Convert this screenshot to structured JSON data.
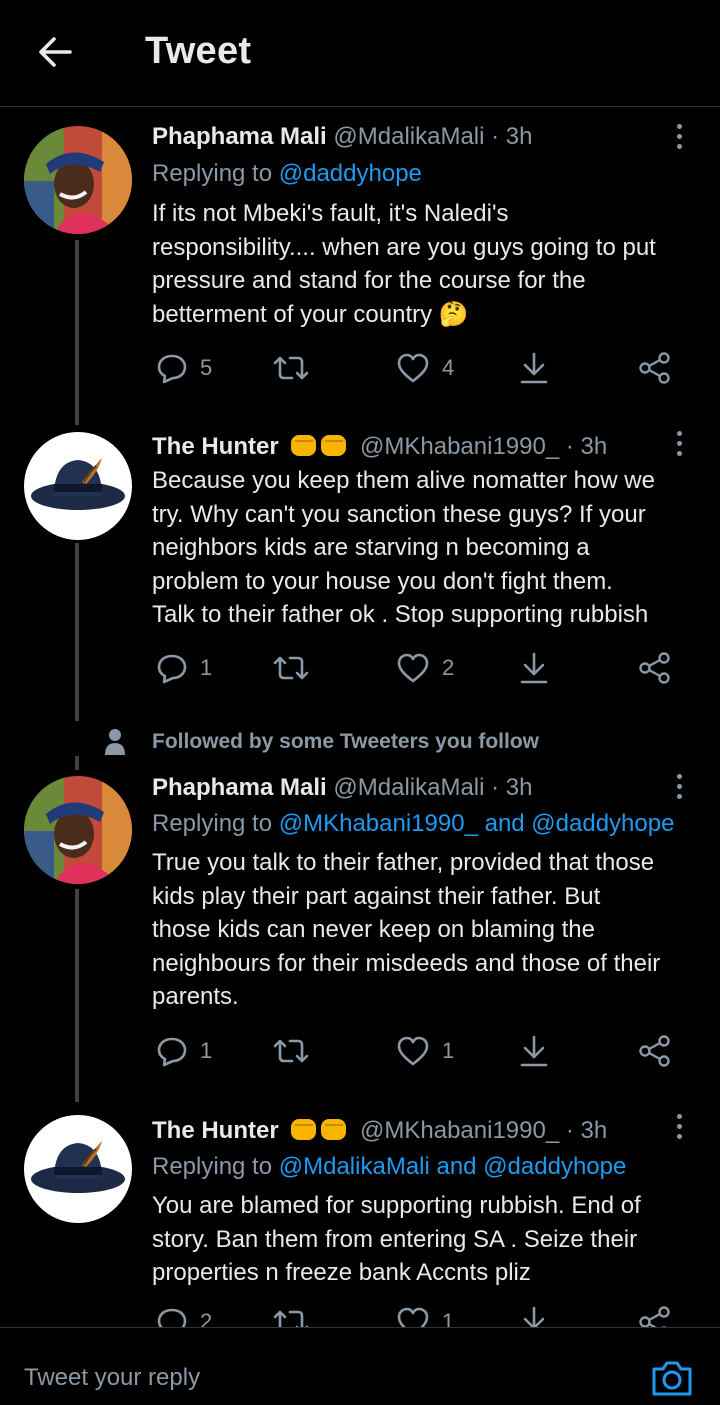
{
  "header": {
    "title": "Tweet"
  },
  "tweets": [
    {
      "name": "Phaphama Mali",
      "handle": "@MdalikaMali",
      "time": "· 3h",
      "reply_prefix": "Replying to ",
      "reply_to": "@daddyhope",
      "body": [
        "If its not Mbeki's fault, it's Naledi's",
        "responsibility.... when are you guys going to put",
        "pressure and stand for the course for the",
        "betterment of your country"
      ],
      "body_emoji": "🤔",
      "replies": "5",
      "retweets": "",
      "likes": "4"
    },
    {
      "name": "The Hunter",
      "handle": "@MKhabani1990_",
      "time": "· 3h",
      "body": [
        "Because you keep them alive nomatter how we",
        "try. Why can't you sanction these guys? If your",
        "neighbors kids are starving n becoming a",
        "problem to your house you don't fight them.",
        "Talk to their father ok . Stop supporting rubbish"
      ],
      "replies": "1",
      "retweets": "",
      "likes": "2"
    },
    {
      "name": "Phaphama Mali",
      "handle": "@MdalikaMali",
      "time": "· 3h",
      "reply_prefix": "Replying to ",
      "reply_to": "@MKhabani1990_ and @daddyhope",
      "body": [
        "True you talk to their father, provided that those",
        "kids play their part against their father. But",
        "those kids can never keep on blaming the",
        "neighbours for their misdeeds and those of their",
        "parents."
      ],
      "replies": "1",
      "retweets": "",
      "likes": "1"
    },
    {
      "name": "The Hunter",
      "handle": "@MKhabani1990_",
      "time": "· 3h",
      "reply_prefix": "Replying to ",
      "reply_to": "@MdalikaMali and @daddyhope",
      "body": [
        "You are blamed for supporting rubbish. End of",
        "story. Ban them from entering SA . Seize their",
        "properties n freeze bank Accnts pliz"
      ],
      "replies": "2",
      "retweets": "",
      "likes": "1"
    }
  ],
  "followed_notice": "Followed by some Tweeters you follow",
  "reply_bar": {
    "placeholder": "Tweet your reply"
  },
  "colors": {
    "background": "#000000",
    "text": "#e7e9ea",
    "muted": "#8b98a5",
    "link": "#1d9bf0",
    "thread_line": "#3e4144"
  },
  "icons": [
    "back-arrow-icon",
    "more-options-icon",
    "reply-icon",
    "retweet-icon",
    "like-icon",
    "bookmark-icon",
    "share-icon",
    "person-icon",
    "camera-icon",
    "fists-emoji",
    "thinking-face-emoji"
  ]
}
